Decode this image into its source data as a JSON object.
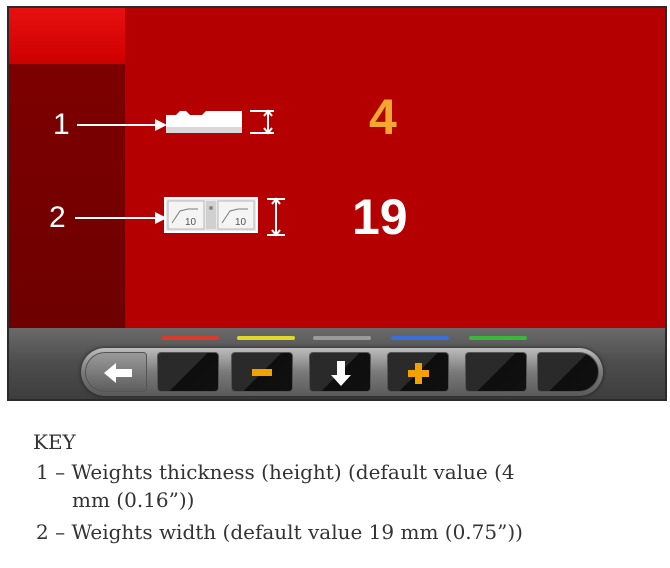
{
  "screen": {
    "rows": [
      {
        "callout": "1",
        "value": "4",
        "icon": "weight-thickness-icon"
      },
      {
        "callout": "2",
        "value": "19",
        "icon": "weight-width-icon"
      }
    ],
    "weight_icon_label_a": "10",
    "weight_icon_label_b": "10"
  },
  "toolbar": {
    "color_indicators": [
      "#d93a2a",
      "#e0d82a",
      "#9a9a9a",
      "#3a6ed8",
      "#3ab83a"
    ],
    "buttons": [
      {
        "icon": "back-arrow-icon"
      },
      {
        "icon": "blank"
      },
      {
        "icon": "minus-icon"
      },
      {
        "icon": "down-arrow-icon"
      },
      {
        "icon": "plus-icon"
      },
      {
        "icon": "blank"
      },
      {
        "icon": "blank"
      }
    ]
  },
  "key": {
    "title": "KEY",
    "line1a": "1 – Weights thickness (height) (default value (4",
    "line1b": "mm (0.16”))",
    "line2": "2 – Weights width (default value 19 mm (0.75”))"
  },
  "colors": {
    "panel_red": "#b40000",
    "left_strip": "#7d0000",
    "value_highlight": "#f2a830",
    "accent_orange": "#f2a200"
  }
}
